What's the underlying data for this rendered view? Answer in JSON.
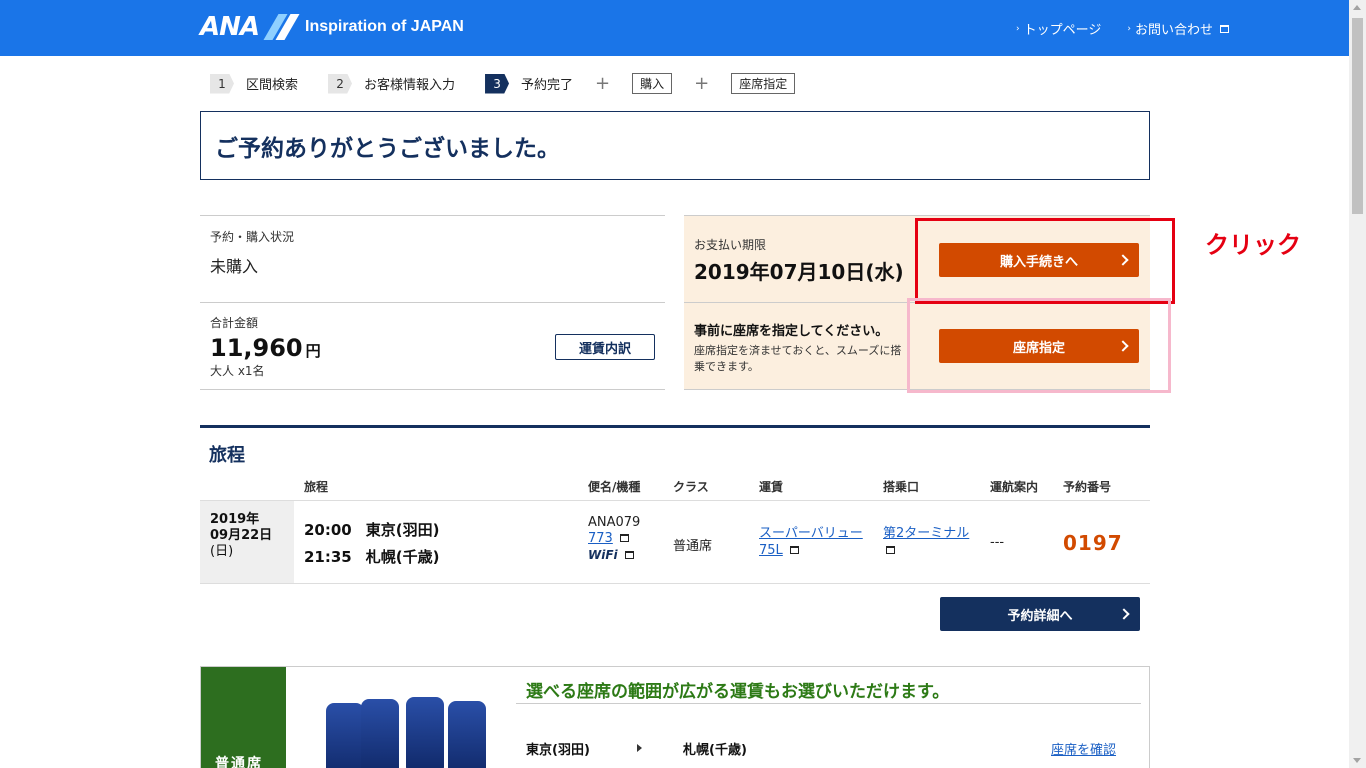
{
  "header": {
    "logo_text": "ANA",
    "tagline": "Inspiration of JAPAN",
    "links": [
      "トップページ",
      "お問い合わせ"
    ]
  },
  "steps": {
    "items": [
      {
        "num": "1",
        "label": "区間検索"
      },
      {
        "num": "2",
        "label": "お客様情報入力"
      },
      {
        "num": "3",
        "label": "予約完了"
      }
    ],
    "extras": [
      "購入",
      "座席指定"
    ]
  },
  "thanks": "ご予約ありがとうございました。",
  "status": {
    "label": "予約・購入状況",
    "value": "未購入"
  },
  "total": {
    "label": "合計金額",
    "amount": "11,960",
    "currency": "円",
    "pax": "大人 x1名",
    "breakdown_button": "運賃内訳"
  },
  "payment": {
    "label": "お支払い期限",
    "deadline": "2019年07月10日(水)",
    "button": "購入手続きへ"
  },
  "seat": {
    "title": "事前に座席を指定してください。",
    "desc": "座席指定を済ませておくと、スムーズに搭乗できます。",
    "button": "座席指定"
  },
  "annotation": "クリック",
  "itinerary": {
    "title": "旅程",
    "headers": [
      "旅程",
      "便名/機種",
      "クラス",
      "運賃",
      "搭乗口",
      "運航案内",
      "予約番号"
    ],
    "row": {
      "date_year": "2019年",
      "date_md": "09月22日",
      "date_dow": "(日)",
      "dep_time": "20:00",
      "dep_city": "東京(羽田)",
      "arr_time": "21:35",
      "arr_city": "札幌(千歳)",
      "flight_no": "ANA079",
      "aircraft": "773",
      "wifi": "WiFi",
      "class": "普通席",
      "fare": "スーパーバリュー75L",
      "gate": "第2ターミナル",
      "ops": "---",
      "res_no": "0197"
    },
    "detail_button": "予約詳細へ"
  },
  "promo": {
    "side_label": "普通席",
    "title": "選べる座席の範囲が広がる運賃もお選びいただけます。",
    "from": "東京(羽田)",
    "to": "札幌(千歳)",
    "link": "座席を確認"
  }
}
